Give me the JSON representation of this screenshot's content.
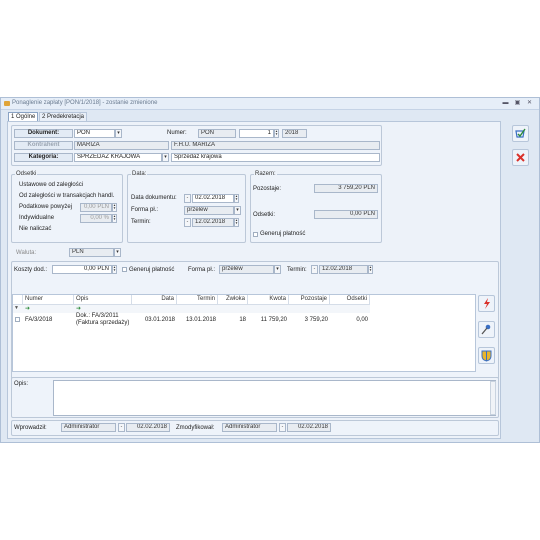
{
  "window": {
    "title": "Ponaglenie zapłaty [PON/1/2018] - zostanie zmienione"
  },
  "tabs": [
    {
      "label": "1 Ogólne"
    },
    {
      "label": "2 Predekretacja"
    }
  ],
  "header": {
    "dokument_label": "Dokument:",
    "dokument_value": "PON",
    "numer_label": "Numer:",
    "numer_prefix": "PON",
    "numer_number": "1",
    "numer_year": "2018",
    "kontrahent_label": "Kontrahent",
    "kontrahent_code": "MARIZA",
    "kontrahent_name": "F.H.U. MARIZA",
    "kategoria_label": "Kategoria:",
    "kategoria_code": "SPRZEDAŻ KRAJOWA",
    "kategoria_desc": "Sprzedaż krajowa"
  },
  "odsetki": {
    "title": "Odsetki",
    "options": [
      "Ustawowe od zaległości",
      "Od zaległości w transakcjach handl.",
      "Podatkowe powyżej",
      "Indywidualne",
      "Nie naliczać"
    ],
    "podatkowe_value": "0,00 PLN",
    "indywidualne_value": "0,00 %"
  },
  "data_group": {
    "title": "Data:",
    "data_dokumentu_label": "Data dokumentu:",
    "data_dokumentu_value": "02.02.2018",
    "forma_pl_label": "Forma pł.:",
    "forma_pl_value": "przelew",
    "termin_label": "Termin:",
    "termin_value": "12.02.2018"
  },
  "razem": {
    "title": "Razem:",
    "pozostaje_label": "Pozostaje:",
    "pozostaje_value": "3 759,20 PLN",
    "odsetki_label": "Odsetki:",
    "odsetki_value": "0,00 PLN",
    "generuj_label": "Generuj płatność"
  },
  "waluta": {
    "label": "Waluta:",
    "value": "PLN"
  },
  "koszty": {
    "label": "Koszty dod.:",
    "value": "0,00 PLN",
    "generuj_label": "Generuj płatność",
    "forma_label": "Forma pł.:",
    "forma_value": "przelew",
    "termin_label": "Termin:",
    "termin_value": "12.02.2018"
  },
  "table": {
    "columns": [
      "Numer",
      "Opis",
      "Data",
      "Termin",
      "Zwłoka",
      "Kwota",
      "Pozostaje",
      "Odsetki"
    ],
    "rows": [
      {
        "numer": "FA/3/2018",
        "opis_line1": "Dok.: FA/3/2011",
        "opis_line2": "(Faktura sprzedaży)",
        "data": "03.01.2018",
        "termin": "13.01.2018",
        "zwloka": "18",
        "kwota": "11 759,20",
        "pozostaje": "3 759,20",
        "odsetki": "0,00"
      }
    ]
  },
  "opis": {
    "label": "Opis:"
  },
  "footer": {
    "wprowadzil_label": "Wprowadził:",
    "wprowadzil_user": "Administrator",
    "wprowadzil_date": "02.02.2018",
    "zmodyfikowal_label": "Zmodyfikował:",
    "zmodyfikowal_user": "Administrator",
    "zmodyfikowal_date": "02.02.2018"
  },
  "colors": {
    "accent": "#3a6fc4",
    "delete": "#d9302a",
    "flash": "#d9302a"
  }
}
